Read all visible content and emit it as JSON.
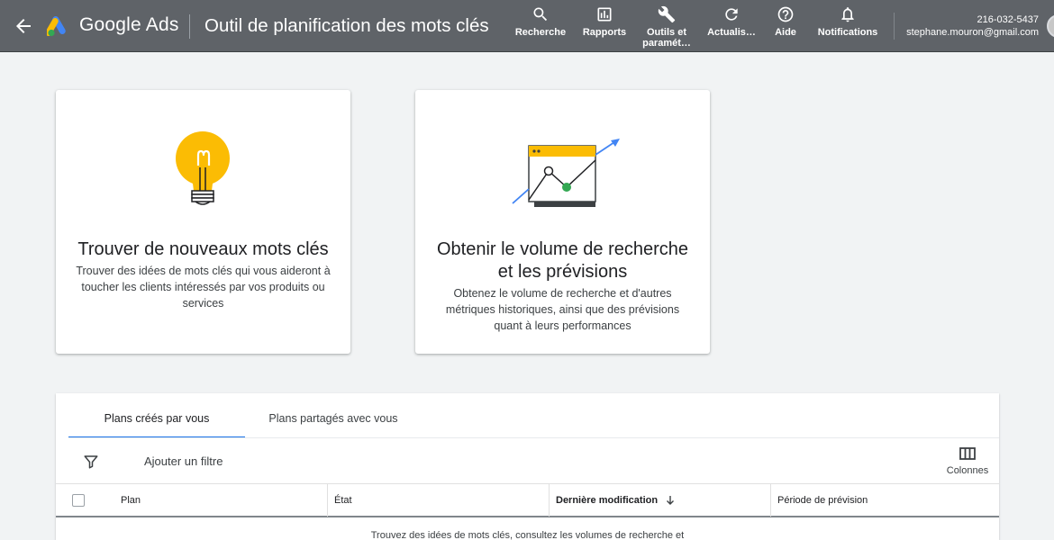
{
  "header": {
    "brand": "Google Ads",
    "page_title": "Outil de planification des mots clés",
    "nav": [
      {
        "label": "Recherche",
        "icon": "search-icon"
      },
      {
        "label": "Rapports",
        "icon": "reports-icon"
      },
      {
        "label": "Outils et paramét…",
        "icon": "wrench-icon"
      },
      {
        "label": "Actualis…",
        "icon": "refresh-icon"
      },
      {
        "label": "Aide",
        "icon": "help-icon"
      },
      {
        "label": "Notifications",
        "icon": "bell-icon"
      }
    ],
    "account_id": "216-032-5437",
    "account_email": "stephane.mouron@gmail.com"
  },
  "cards": [
    {
      "title": "Trouver de nouveaux mots clés",
      "description": "Trouver des idées de mots clés qui vous aideront à toucher les clients intéressés par vos produits ou services",
      "icon": "lightbulb-icon"
    },
    {
      "title": "Obtenir le volume de recherche et les prévisions",
      "description": "Obtenez le volume de recherche et d'autres métriques historiques, ainsi que des prévisions quant à leurs performances",
      "icon": "trend-chart-icon"
    }
  ],
  "plans": {
    "tabs": [
      "Plans créés par vous",
      "Plans partagés avec vous"
    ],
    "active_tab": 0,
    "add_filter": "Ajouter un filtre",
    "columns_label": "Colonnes",
    "table_headers": [
      "Plan",
      "État",
      "Dernière modification",
      "Période de prévision"
    ],
    "empty_message": "Trouvez des idées de mots clés, consultez les volumes de recherche et"
  },
  "colors": {
    "header_bg": "#5f6368",
    "accent": "#1a73e8",
    "bulb_yellow": "#fbbc04",
    "chart_green": "#34a853",
    "chart_blue": "#4285f4"
  }
}
